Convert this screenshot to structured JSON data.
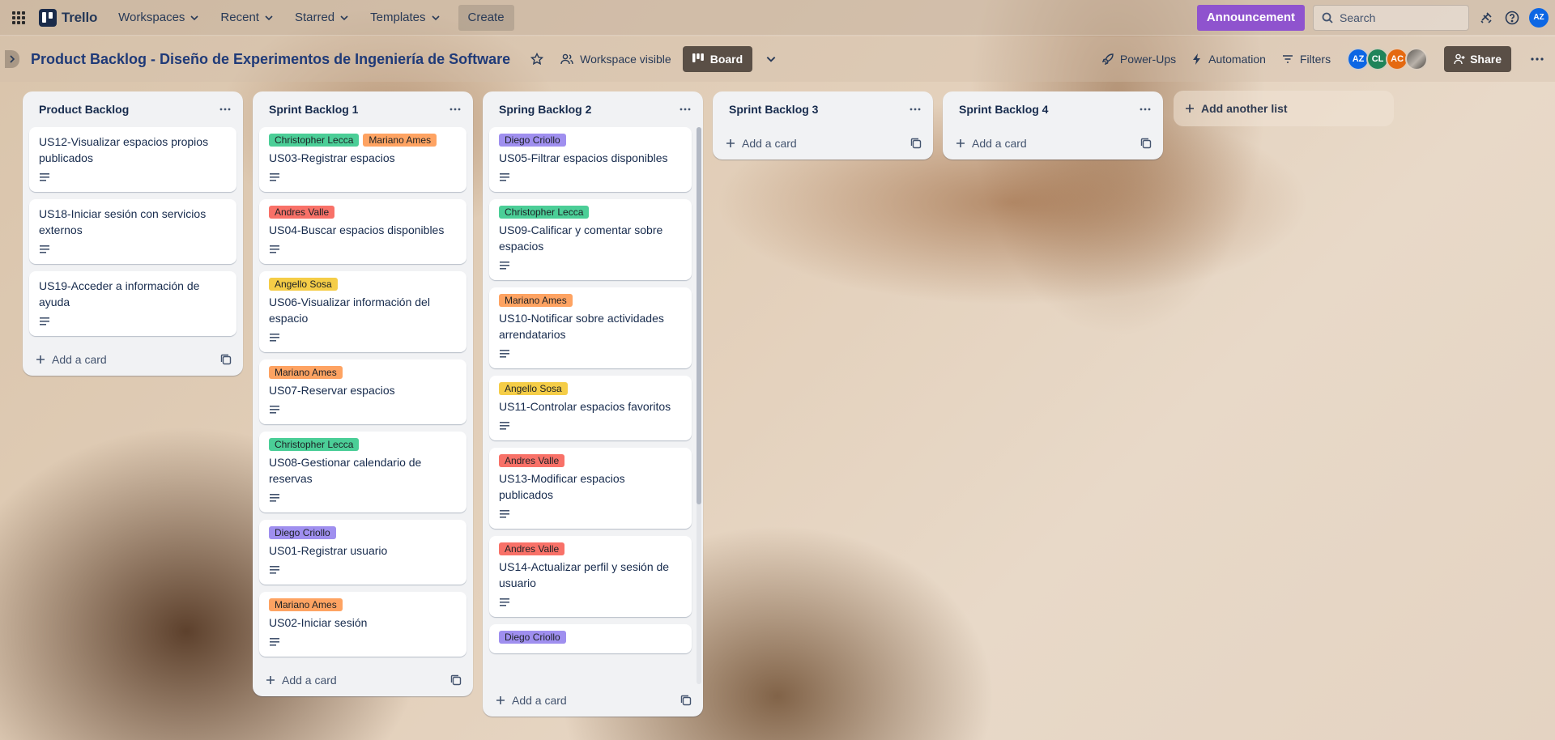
{
  "colors": {
    "green": "#4bce97",
    "orange": "#fea362",
    "red": "#f87168",
    "yellow": "#f5cd47",
    "purple": "#9f8fef",
    "announcement": "#8f53ce",
    "board_title": "#1f3a78"
  },
  "topbar": {
    "app_name": "Trello",
    "nav": [
      "Workspaces",
      "Recent",
      "Starred",
      "Templates"
    ],
    "create_label": "Create",
    "announcement_label": "Announcement",
    "search_placeholder": "Search",
    "user_initials": "AZ",
    "icons": [
      "app-switcher-icon",
      "notifications-icon",
      "help-icon"
    ]
  },
  "board": {
    "title": "Product Backlog - Diseño de Experimentos de Ingeniería de Software",
    "visibility_label": "Workspace visible",
    "view_label": "Board",
    "powerups_label": "Power-Ups",
    "automation_label": "Automation",
    "filters_label": "Filters",
    "share_label": "Share",
    "members": [
      {
        "initials": "AZ",
        "color": "#0c66e4"
      },
      {
        "initials": "CL",
        "color": "#1f845a"
      },
      {
        "initials": "AC",
        "color": "#e56910"
      },
      {
        "initials": "",
        "color": "#7a7268"
      }
    ]
  },
  "lists": [
    {
      "title": "Product Backlog",
      "cards": [
        {
          "labels": [],
          "title": "US12-Visualizar espacios propios publicados"
        },
        {
          "labels": [],
          "title": "US18-Iniciar sesión con servicios externos"
        },
        {
          "labels": [],
          "title": "US19-Acceder a información de ayuda"
        }
      ],
      "add_label": "Add a card"
    },
    {
      "title": "Sprint Backlog 1",
      "cards": [
        {
          "labels": [
            {
              "text": "Christopher Lecca",
              "color": "green"
            },
            {
              "text": "Mariano Ames",
              "color": "orange"
            }
          ],
          "title": "US03-Registrar espacios"
        },
        {
          "labels": [
            {
              "text": "Andres Valle",
              "color": "red"
            }
          ],
          "title": "US04-Buscar espacios disponibles"
        },
        {
          "labels": [
            {
              "text": "Angello Sosa",
              "color": "yellow"
            }
          ],
          "title": "US06-Visualizar información del espacio"
        },
        {
          "labels": [
            {
              "text": "Mariano Ames",
              "color": "orange"
            }
          ],
          "title": "US07-Reservar espacios"
        },
        {
          "labels": [
            {
              "text": "Christopher Lecca",
              "color": "green"
            }
          ],
          "title": "US08-Gestionar calendario de reservas"
        },
        {
          "labels": [
            {
              "text": "Diego Criollo",
              "color": "purple"
            }
          ],
          "title": "US01-Registrar usuario"
        },
        {
          "labels": [
            {
              "text": "Mariano Ames",
              "color": "orange"
            }
          ],
          "title": "US02-Iniciar sesión"
        }
      ],
      "add_label": "Add a card"
    },
    {
      "title": "Spring Backlog 2",
      "cards": [
        {
          "labels": [
            {
              "text": "Diego Criollo",
              "color": "purple"
            }
          ],
          "title": "US05-Filtrar espacios disponibles"
        },
        {
          "labels": [
            {
              "text": "Christopher Lecca",
              "color": "green"
            }
          ],
          "title": "US09-Calificar y comentar sobre espacios"
        },
        {
          "labels": [
            {
              "text": "Mariano Ames",
              "color": "orange"
            }
          ],
          "title": "US10-Notificar sobre actividades arrendatarios"
        },
        {
          "labels": [
            {
              "text": "Angello Sosa",
              "color": "yellow"
            }
          ],
          "title": "US11-Controlar espacios favoritos"
        },
        {
          "labels": [
            {
              "text": "Andres Valle",
              "color": "red"
            }
          ],
          "title": "US13-Modificar espacios publicados"
        },
        {
          "labels": [
            {
              "text": "Andres Valle",
              "color": "red"
            }
          ],
          "title": "US14-Actualizar perfil y sesión de usuario"
        },
        {
          "labels": [
            {
              "text": "Diego Criollo",
              "color": "purple"
            }
          ],
          "title": ""
        }
      ],
      "add_label": "Add a card"
    },
    {
      "title": "Sprint Backlog 3",
      "cards": [],
      "add_label": "Add a card"
    },
    {
      "title": "Sprint Backlog 4",
      "cards": [],
      "add_label": "Add a card"
    }
  ],
  "add_list_label": "Add another list"
}
